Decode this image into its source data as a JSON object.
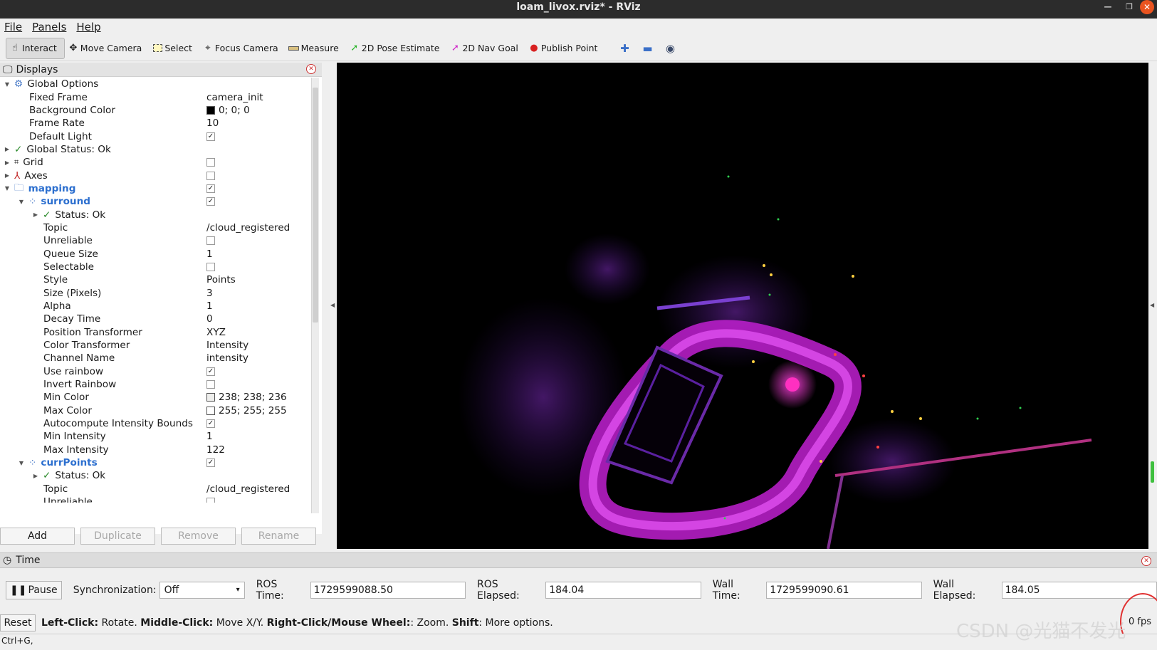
{
  "window": {
    "title": "loam_livox.rviz* - RViz"
  },
  "menu": {
    "items": [
      "File",
      "Panels",
      "Help"
    ]
  },
  "toolbar": {
    "tools": [
      "Interact",
      "Move Camera",
      "Select",
      "Focus Camera",
      "Measure",
      "2D Pose Estimate",
      "2D Nav Goal",
      "Publish Point"
    ],
    "icons": [
      "plus-icon",
      "minus-icon",
      "eye-icon"
    ]
  },
  "displays": {
    "title": "Displays",
    "rows": [
      {
        "name": "Global Options",
        "value": ""
      },
      {
        "name": "Fixed Frame",
        "value": "camera_init"
      },
      {
        "name": "Background Color",
        "value": "0; 0; 0"
      },
      {
        "name": "Frame Rate",
        "value": "10"
      },
      {
        "name": "Default Light",
        "value": ""
      },
      {
        "name": "Global Status: Ok",
        "value": ""
      },
      {
        "name": "Grid",
        "value": ""
      },
      {
        "name": "Axes",
        "value": ""
      },
      {
        "name": "mapping",
        "value": ""
      },
      {
        "name": "surround",
        "value": ""
      },
      {
        "name": "Status: Ok",
        "value": ""
      },
      {
        "name": "Topic",
        "value": "/cloud_registered"
      },
      {
        "name": "Unreliable",
        "value": ""
      },
      {
        "name": "Queue Size",
        "value": "1"
      },
      {
        "name": "Selectable",
        "value": ""
      },
      {
        "name": "Style",
        "value": "Points"
      },
      {
        "name": "Size (Pixels)",
        "value": "3"
      },
      {
        "name": "Alpha",
        "value": "1"
      },
      {
        "name": "Decay Time",
        "value": "0"
      },
      {
        "name": "Position Transformer",
        "value": "XYZ"
      },
      {
        "name": "Color Transformer",
        "value": "Intensity"
      },
      {
        "name": "Channel Name",
        "value": "intensity"
      },
      {
        "name": "Use rainbow",
        "value": ""
      },
      {
        "name": "Invert Rainbow",
        "value": ""
      },
      {
        "name": "Min Color",
        "value": "238; 238; 236"
      },
      {
        "name": "Max Color",
        "value": "255; 255; 255"
      },
      {
        "name": "Autocompute Intensity Bounds",
        "value": ""
      },
      {
        "name": "Min Intensity",
        "value": "1"
      },
      {
        "name": "Max Intensity",
        "value": "122"
      },
      {
        "name": "currPoints",
        "value": ""
      },
      {
        "name": "Status: Ok",
        "value": ""
      },
      {
        "name": "Topic",
        "value": "/cloud_registered"
      },
      {
        "name": "Unreliable",
        "value": ""
      }
    ],
    "buttons": [
      "Add",
      "Duplicate",
      "Remove",
      "Rename"
    ]
  },
  "time": {
    "title": "Time",
    "pause": "Pause",
    "sync_label": "Synchronization:",
    "sync_value": "Off",
    "ros_time_label": "ROS Time:",
    "ros_time": "1729599088.50",
    "ros_elapsed_label": "ROS Elapsed:",
    "ros_elapsed": "184.04",
    "wall_time_label": "Wall Time:",
    "wall_time": "1729599090.61",
    "wall_elapsed_label": "Wall Elapsed:",
    "wall_elapsed": "184.05"
  },
  "status": {
    "reset": "Reset",
    "k1": "Left-Click:",
    "t1": " Rotate. ",
    "k2": "Middle-Click:",
    "t2": " Move X/Y. ",
    "k3": "Right-Click/Mouse Wheel:",
    "t3": ": Zoom. ",
    "k4": "Shift",
    "t4": ": More options.",
    "fps": "0 fps"
  },
  "hint": "Ctrl+G,",
  "watermark": "CSDN @光猫不发光"
}
